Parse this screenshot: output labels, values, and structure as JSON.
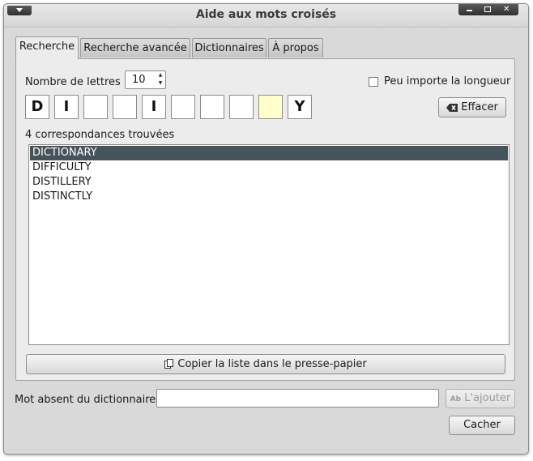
{
  "window": {
    "title": "Aide aux mots croisés"
  },
  "tabs": [
    {
      "label": "Recherche"
    },
    {
      "label": "Recherche avancée"
    },
    {
      "label": "Dictionnaires"
    },
    {
      "label": "À propos"
    }
  ],
  "search": {
    "letter_count_label": "Nombre de lettres :",
    "letter_count_value": "10",
    "ignore_length_label": "Peu importe la longueur",
    "ignore_length_checked": false,
    "cells": [
      "D",
      "I",
      "",
      "",
      "I",
      "",
      "",
      "",
      "",
      "Y"
    ],
    "highlighted_cell_index": 8,
    "clear_button": "Effacer",
    "matches_label": "4 correspondances trouvées",
    "results": [
      "DICTIONARY",
      "DIFFICULTY",
      "DISTILLERY",
      "DISTINCTLY"
    ],
    "selected_result_index": 0,
    "copy_button": "Copier la liste dans le presse-papier"
  },
  "footer": {
    "missing_word_label": "Mot absent du dictionnaire :",
    "missing_word_value": "",
    "add_button": "L'ajouter",
    "cancel_button": "Cacher"
  },
  "colors": {
    "selection": "#45535b",
    "highlight_cell": "#ffffcc"
  }
}
